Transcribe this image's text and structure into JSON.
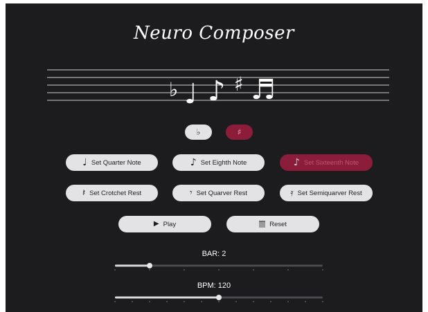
{
  "app": {
    "title": "Neuro Composer"
  },
  "staff": {
    "notes": [
      {
        "kind": "flat-accidental",
        "glyph": "♭"
      },
      {
        "kind": "quarter-note",
        "glyph": "♩"
      },
      {
        "kind": "eighth-note",
        "glyph": "♪"
      },
      {
        "kind": "sharp-accidental",
        "glyph": "♯"
      },
      {
        "kind": "sixteenth-note",
        "glyph": "♬"
      }
    ]
  },
  "accidentals": {
    "flat": {
      "glyph": "♭",
      "selected": false
    },
    "sharp": {
      "glyph": "♯",
      "selected": true
    }
  },
  "note_buttons": {
    "quarter": {
      "label": "Set Quarter Note",
      "icon": "♩",
      "selected": false
    },
    "eighth": {
      "label": "Set Eighth Note",
      "icon": "♪",
      "selected": false
    },
    "sixteenth": {
      "label": "Set Sixteenth Note",
      "icon": "♪",
      "selected": true
    }
  },
  "rest_buttons": {
    "crotchet": {
      "label": "Set Crotchet Rest",
      "icon": "𝄽"
    },
    "quaver": {
      "label": "Set Quarver Rest",
      "icon": "𝄾"
    },
    "semiquaver": {
      "label": "Set Semiquarver Rest",
      "icon": "𝄿"
    }
  },
  "controls": {
    "play": {
      "label": "Play",
      "icon": "▶"
    },
    "reset": {
      "label": "Reset",
      "icon": "trash-icon"
    }
  },
  "bar": {
    "label": "BAR: 2",
    "value": 2,
    "min": 1,
    "max": 7
  },
  "bpm": {
    "label": "BPM: 120",
    "value": 120,
    "min": 40,
    "max": 200,
    "ticks": 13
  },
  "colors": {
    "background": "#1c1c1e",
    "accent": "#8c1d3a",
    "button": "#e3e3e6",
    "staff_line": "#cfcfcf"
  }
}
